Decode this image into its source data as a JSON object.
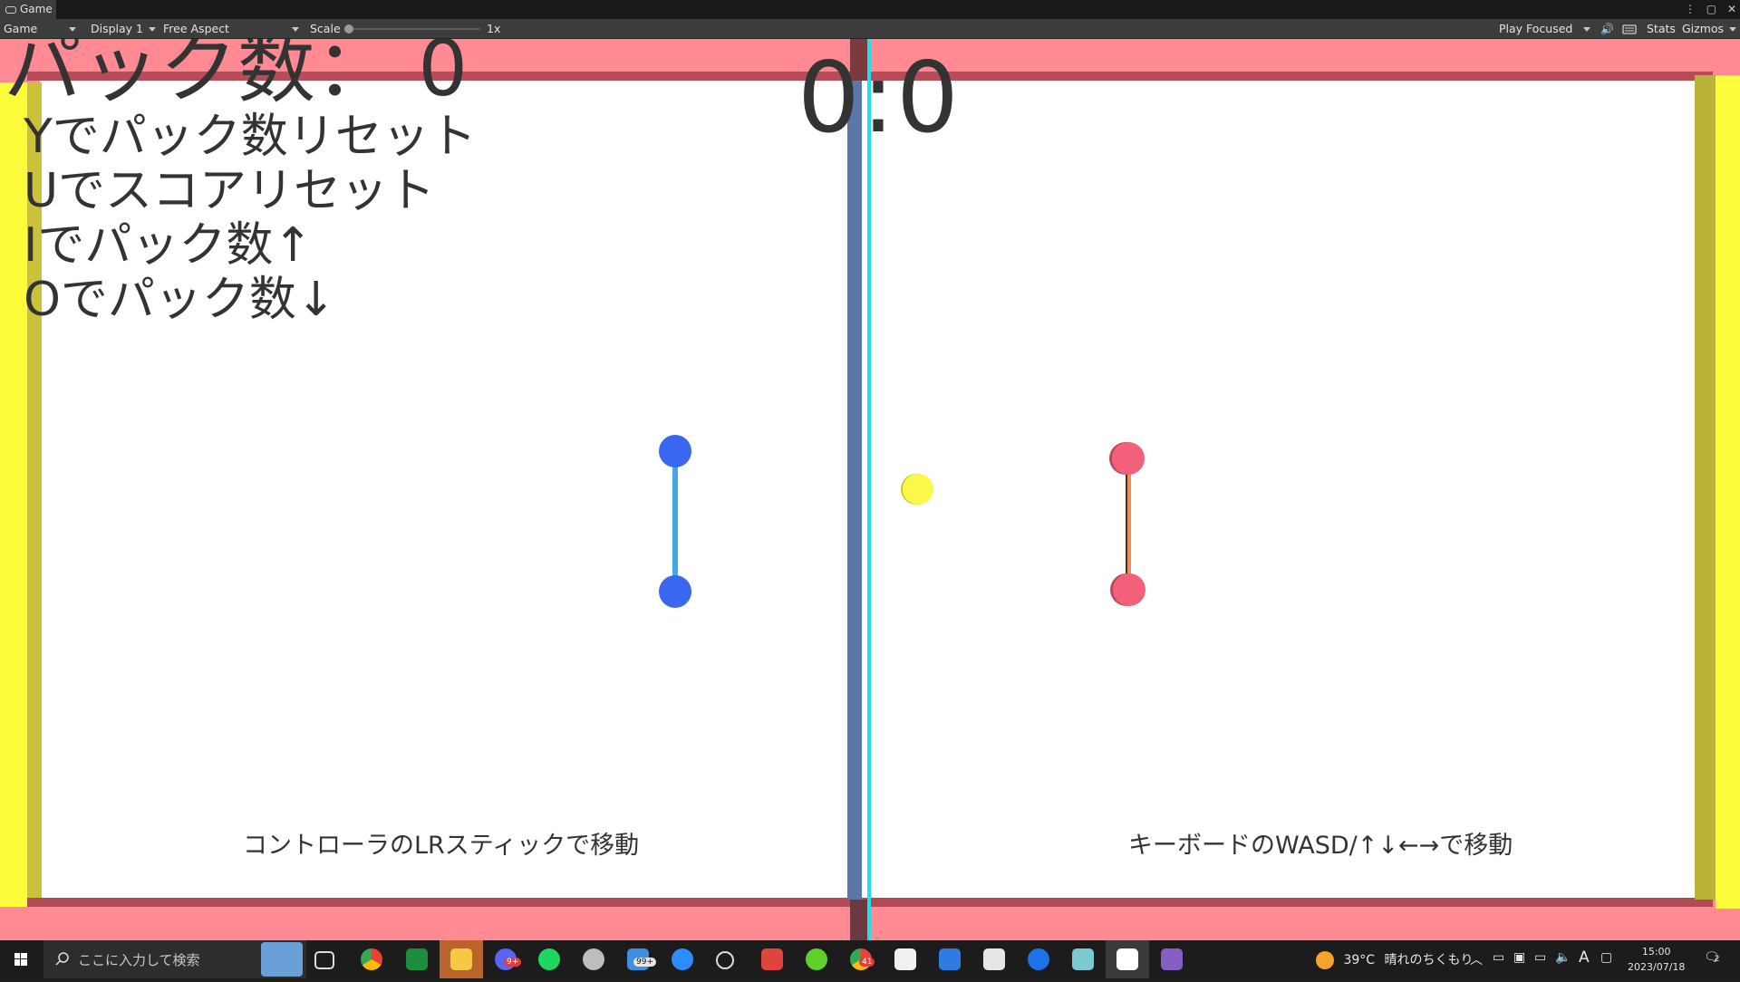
{
  "editor": {
    "tab_title": "Game",
    "view_mode": "Game",
    "display": "Display 1",
    "aspect": "Free Aspect",
    "scale_label": "Scale",
    "scale_value": "1x",
    "play_mode": "Play Focused",
    "stats_label": "Stats",
    "gizmos_label": "Gizmos"
  },
  "hud": {
    "puck_count_text": "パック数： 0",
    "score_text": "0:0",
    "help_lines": [
      "Yでパック数リセット",
      "Uでスコアリセット",
      "Iでパック数↑",
      "Oでパック数↓"
    ],
    "left_hint": "コントローラのLRスティックで移動",
    "right_hint": "キーボードのWASD/↑↓←→で移動"
  },
  "colors": {
    "arena_rim": "#ff8a94",
    "side_wall": "#fdfd3c",
    "player_left": "#3a67f0",
    "player_left_bar": "#45a8e6",
    "player_right": "#f2607a",
    "player_right_bar": "#f58a5a",
    "puck": "#fbf84a",
    "center_line": "#22e0e8"
  },
  "taskbar": {
    "search_placeholder": "ここに入力して検索",
    "weather_temp": "39°C",
    "weather_text": "晴れのちくもり",
    "ime_indicator": "A",
    "time": "15:00",
    "date": "2023/07/18",
    "notification_count": "2",
    "mail_badge": "99+",
    "discord_badge": "9+",
    "chrome_badge": "41"
  }
}
